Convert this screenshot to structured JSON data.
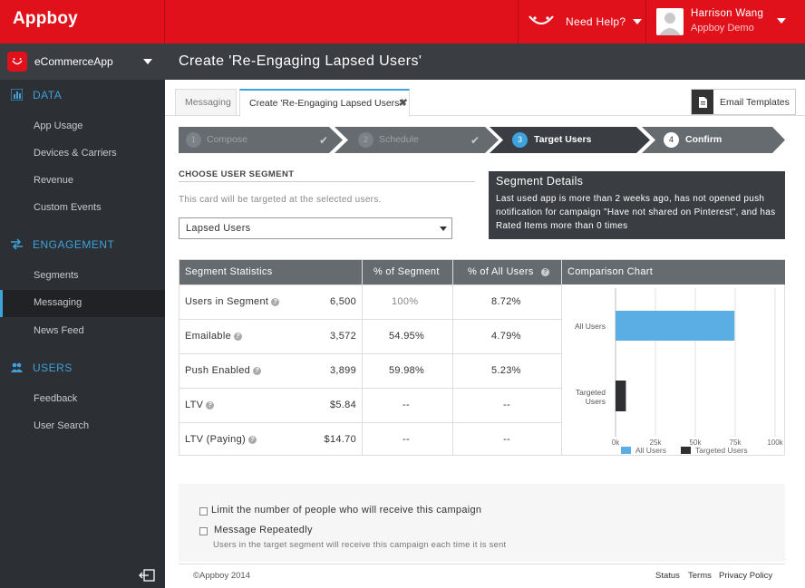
{
  "header": {
    "logo_text": "Appboy",
    "help_label": "Need Help?",
    "user_name": "Harrison Wang",
    "user_company": "Appboy Demo"
  },
  "sidebar": {
    "app_name": "eCommerceApp",
    "sections": [
      {
        "label": "DATA",
        "icon": "bar-chart-icon"
      },
      {
        "label": "ENGAGEMENT",
        "icon": "exchange-icon"
      },
      {
        "label": "USERS",
        "icon": "users-icon"
      }
    ],
    "data_items": [
      "App Usage",
      "Devices & Carriers",
      "Revenue",
      "Custom Events"
    ],
    "engagement_items": [
      "Segments",
      "Messaging",
      "News Feed"
    ],
    "users_items": [
      "Feedback",
      "User Search"
    ],
    "active_item": "Messaging"
  },
  "page": {
    "title": "Create 'Re-Engaging Lapsed Users'"
  },
  "tabs": {
    "messaging_label": "Messaging",
    "current_label": "Create 'Re-Engaging Lapsed Users'",
    "close_glyph": "✖",
    "email_templates_label": "Email Templates"
  },
  "steps": [
    {
      "num": "1",
      "label": "Compose",
      "state": "done"
    },
    {
      "num": "2",
      "label": "Schedule",
      "state": "done"
    },
    {
      "num": "3",
      "label": "Target Users",
      "state": "current"
    },
    {
      "num": "4",
      "label": "Confirm",
      "state": "future"
    }
  ],
  "segment": {
    "heading": "CHOOSE USER SEGMENT",
    "description": "This card will be targeted at the selected users.",
    "selected": "Lapsed Users"
  },
  "details": {
    "title": "Segment Details",
    "text": "Last used app is more than 2 weeks ago, has not opened push notification for campaign \"Have not shared on Pinterest\", and has Rated Items more than 0 times"
  },
  "stats": {
    "headers": [
      "Segment Statistics",
      "% of Segment",
      "% of All Users"
    ],
    "rows": [
      {
        "label": "Users in Segment",
        "value": "6,500",
        "pct_segment": "100%",
        "pct_all": "8.72%"
      },
      {
        "label": "Emailable",
        "value": "3,572",
        "pct_segment": "54.95%",
        "pct_all": "4.79%"
      },
      {
        "label": "Push Enabled",
        "value": "3,899",
        "pct_segment": "59.98%",
        "pct_all": "5.23%"
      },
      {
        "label": "LTV",
        "value": "$5.84",
        "pct_segment": "--",
        "pct_all": "--"
      },
      {
        "label": "LTV (Paying)",
        "value": "$14.70",
        "pct_segment": "--",
        "pct_all": "--"
      }
    ]
  },
  "chart_title": "Comparison Chart",
  "chart_data": {
    "type": "bar",
    "orientation": "horizontal",
    "categories": [
      "All Users",
      "Targeted Users"
    ],
    "values": [
      74550,
      6500
    ],
    "xlim": [
      0,
      100000
    ],
    "x_ticks": [
      "0k",
      "25k",
      "50k",
      "75k",
      "100k"
    ],
    "colors": [
      "#5aaee3",
      "#2e3033"
    ],
    "legend": [
      "All Users",
      "Targeted Users"
    ],
    "legend_position": "bottom",
    "grid": true
  },
  "options": {
    "limit_label": "Limit the number of people who will receive this campaign",
    "repeat_label": "Message Repeatedly",
    "repeat_sub": "Users in the target segment will receive this campaign each time it is sent"
  },
  "footer": {
    "copyright": "©Appboy 2014",
    "links": [
      "Status",
      "Terms",
      "Privacy Policy"
    ]
  },
  "colors": {
    "brand_red": "#e0111b",
    "accent_blue": "#3ea2dd",
    "sidebar_bg": "#2c2f33"
  }
}
